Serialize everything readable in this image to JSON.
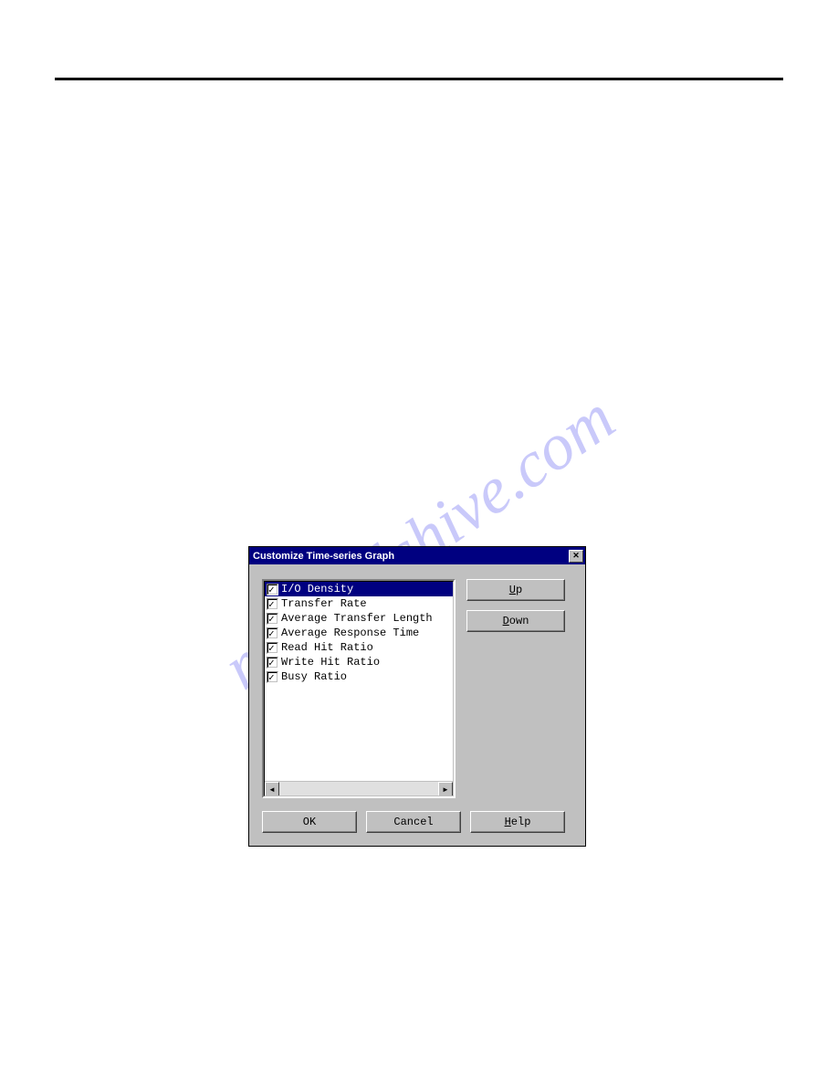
{
  "watermark": "manualshive.com",
  "dialog": {
    "title": "Customize Time-series Graph",
    "items": [
      {
        "label": "I/O Density",
        "checked": true,
        "selected": true
      },
      {
        "label": "Transfer Rate",
        "checked": true,
        "selected": false
      },
      {
        "label": "Average Transfer Length",
        "checked": true,
        "selected": false
      },
      {
        "label": "Average Response Time",
        "checked": true,
        "selected": false
      },
      {
        "label": "Read Hit Ratio",
        "checked": true,
        "selected": false
      },
      {
        "label": "Write Hit Ratio",
        "checked": true,
        "selected": false
      },
      {
        "label": "Busy Ratio",
        "checked": true,
        "selected": false
      }
    ],
    "buttons": {
      "up": "Up",
      "down": "Down",
      "ok": "OK",
      "cancel": "Cancel",
      "help": "Help"
    }
  }
}
